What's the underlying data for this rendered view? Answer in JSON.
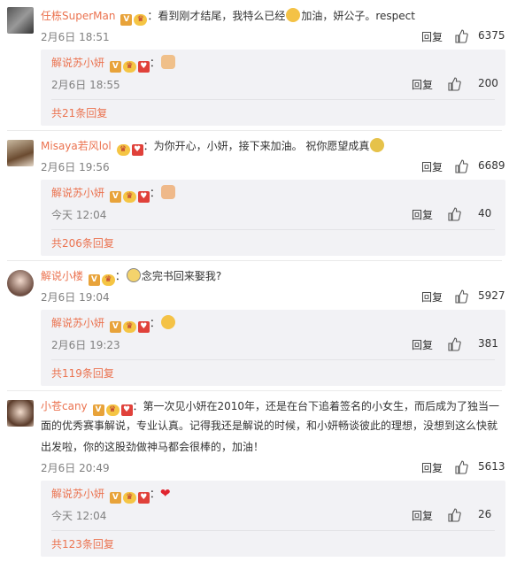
{
  "comments": [
    {
      "user": "任栋SuperMan",
      "text_before": "：看到刚才结尾，我特么已经",
      "text_after": "加油，妍公子。respect",
      "time": "2月6日 18:51",
      "reply_label": "回复",
      "likes": "6375",
      "reply": {
        "user": "解说苏小妍",
        "text": "：",
        "time": "2月6日 18:55",
        "reply_label": "回复",
        "likes": "200"
      },
      "more": "共21条回复"
    },
    {
      "user": "Misaya若风lol",
      "text_before": "：为你开心，小妍，接下来加油。 祝你愿望成真",
      "text_after": "",
      "time": "2月6日 19:56",
      "reply_label": "回复",
      "likes": "6689",
      "reply": {
        "user": "解说苏小妍",
        "text": "：",
        "time": "今天 12:04",
        "reply_label": "回复",
        "likes": "40"
      },
      "more": "共206条回复"
    },
    {
      "user": "解说小楼",
      "text_before": "：",
      "text_after": "念完书回来娶我?",
      "time": "2月6日 19:04",
      "reply_label": "回复",
      "likes": "5927",
      "reply": {
        "user": "解说苏小妍",
        "text": "：",
        "time": "2月6日 19:23",
        "reply_label": "回复",
        "likes": "381"
      },
      "more": "共119条回复"
    },
    {
      "user": "小苍cany",
      "line1": "：第一次见小妍在2010年，还是在台下追着签名的小女生，而后成为了独当一",
      "line2": "面的优秀赛事解说，专业认真。记得我还是解说的时候，和小妍畅谈彼此的理想，没想到这么快就",
      "line3": "出发啦，你的这股劲做神马都会很棒的，加油！",
      "time": "2月6日 20:49",
      "reply_label": "回复",
      "likes": "5613",
      "reply": {
        "user": "解说苏小妍",
        "text": "：",
        "time": "今天 12:04",
        "reply_label": "回复",
        "likes": "26"
      },
      "more": "共123条回复"
    }
  ],
  "colors": {
    "username": "#eb7350",
    "time": "#808080",
    "reply_bg": "#f2f2f5"
  }
}
